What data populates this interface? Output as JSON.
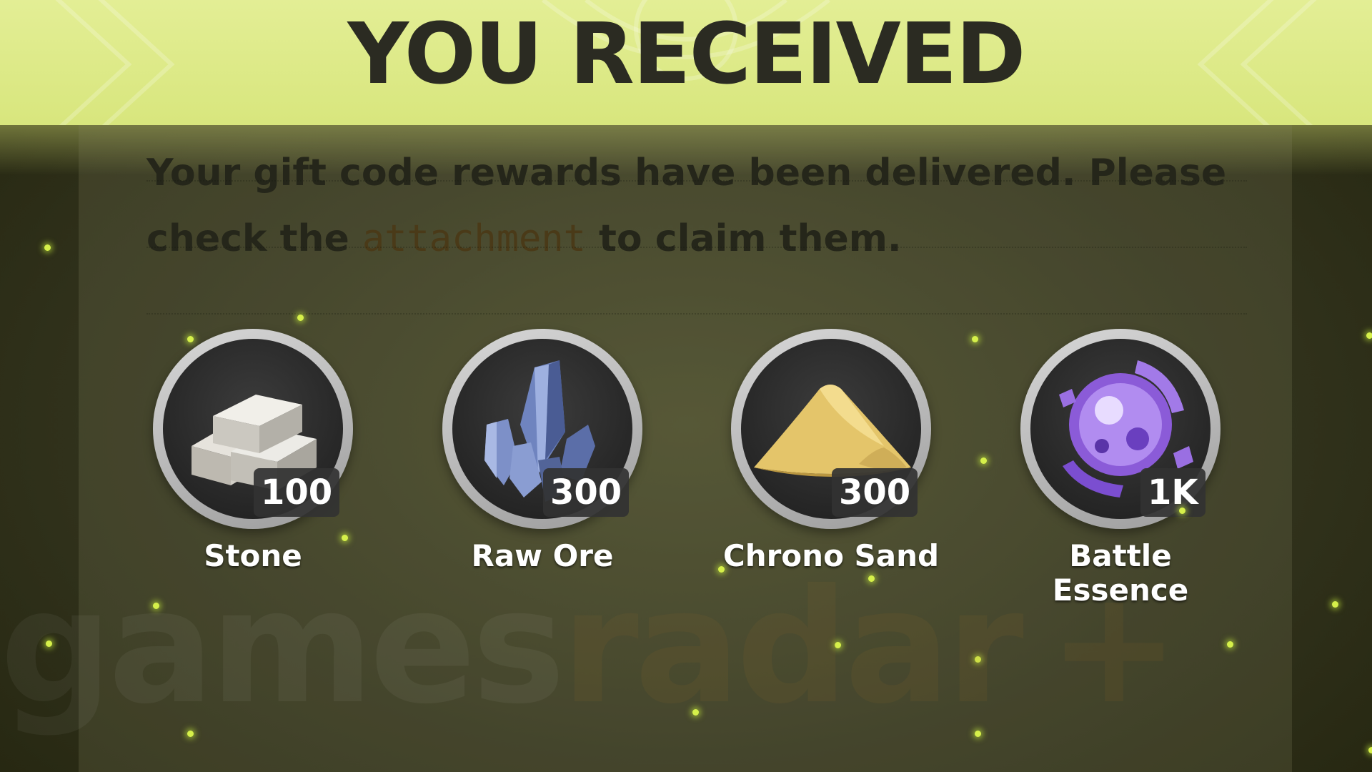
{
  "header": {
    "title": "YOU RECEIVED"
  },
  "message": {
    "before": "Your gift code rewards have been delivered. Please check the ",
    "highlight": "attachment",
    "after": " to claim them."
  },
  "items": [
    {
      "name": "Stone",
      "count": "100",
      "icon": "stone-blocks-icon"
    },
    {
      "name": "Raw Ore",
      "count": "300",
      "icon": "raw-ore-crystal-icon"
    },
    {
      "name": "Chrono Sand",
      "count": "300",
      "icon": "chrono-sand-pile-icon"
    },
    {
      "name": "Battle Essence",
      "count": "1K",
      "icon": "battle-essence-orb-icon"
    }
  ],
  "watermark": {
    "part1": "games",
    "part2": "radar",
    "part3": "+"
  },
  "colors": {
    "header_bg": "#dce982",
    "title_text": "#2b2b22",
    "background": "#33341e",
    "highlight_text": "#4a3a18",
    "sparkle": "#d6f04a"
  }
}
